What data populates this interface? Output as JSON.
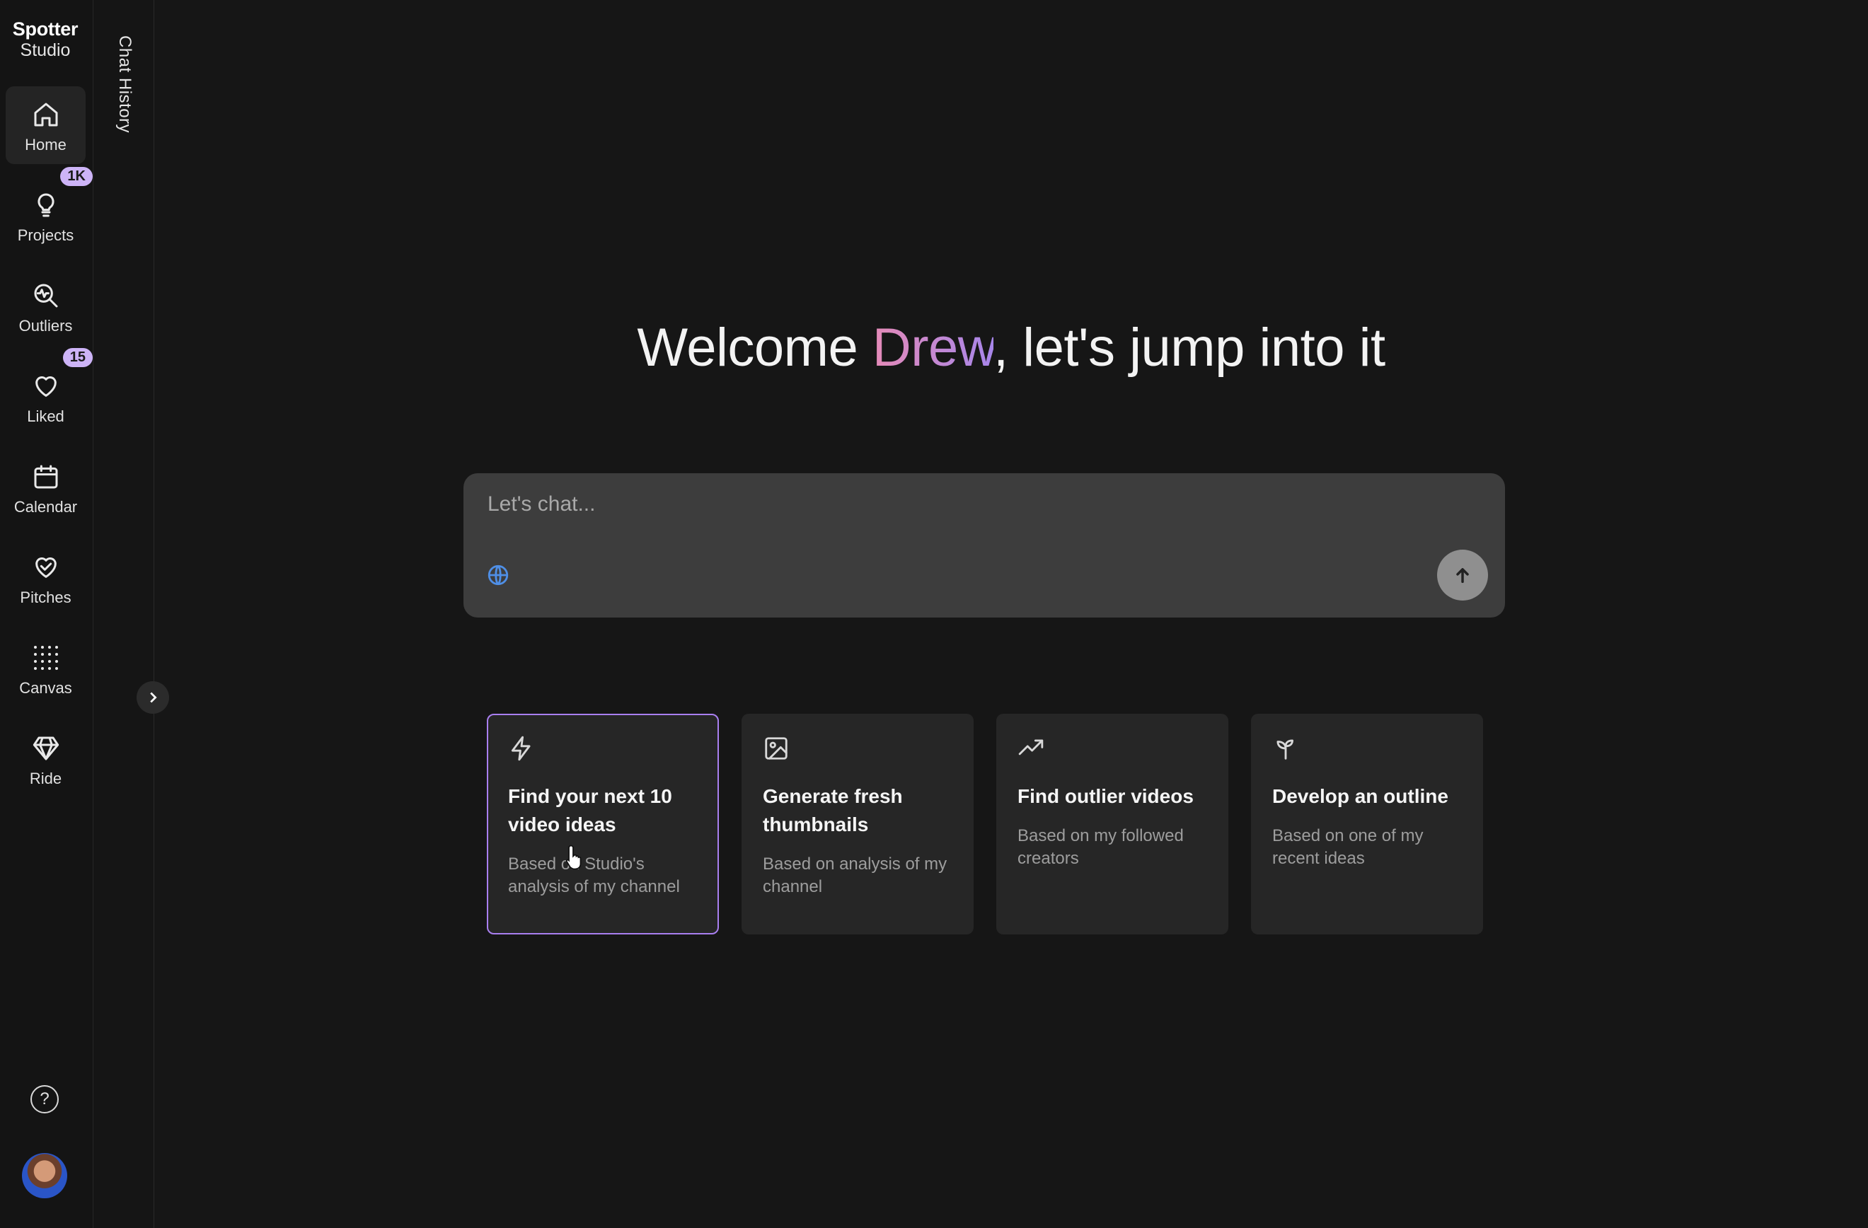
{
  "app": {
    "logo_line1": "Spotter",
    "logo_line2": "Studio"
  },
  "nav": {
    "items": [
      {
        "label": "Home",
        "icon": "home-icon",
        "active": true
      },
      {
        "label": "Projects",
        "icon": "lightbulb-icon",
        "badge": "1K"
      },
      {
        "label": "Outliers",
        "icon": "outliers-search-icon"
      },
      {
        "label": "Liked",
        "icon": "heart-icon",
        "badge": "15"
      },
      {
        "label": "Calendar",
        "icon": "calendar-icon"
      },
      {
        "label": "Pitches",
        "icon": "handshake-heart-icon"
      },
      {
        "label": "Canvas",
        "icon": "dot-grid-icon"
      },
      {
        "label": "Ride",
        "icon": "diamond-icon"
      }
    ],
    "help_symbol": "?"
  },
  "history": {
    "label": "Chat History"
  },
  "main": {
    "welcome_prefix": "Welcome ",
    "user_name": "Drew",
    "welcome_suffix": ", let's jump into it",
    "chat_placeholder": "Let's chat...",
    "chat_value": ""
  },
  "cards": [
    {
      "icon": "lightning-icon",
      "title": "Find your next 10 video ideas",
      "subtitle": "Based on Studio's analysis of my channel",
      "selected": true
    },
    {
      "icon": "image-icon",
      "title": "Generate fresh thumbnails",
      "subtitle": "Based on analysis of my channel"
    },
    {
      "icon": "trending-up-icon",
      "title": "Find outlier videos",
      "subtitle": "Based on my followed creators"
    },
    {
      "icon": "sprout-icon",
      "title": "Develop an outline",
      "subtitle": "Based on one of my recent ideas"
    }
  ],
  "colors": {
    "background": "#161616",
    "badge": "#cdb4f7",
    "accent_selected": "#a97ff0",
    "name_gradient_start": "#e58ab7",
    "name_gradient_end": "#a786ea"
  }
}
